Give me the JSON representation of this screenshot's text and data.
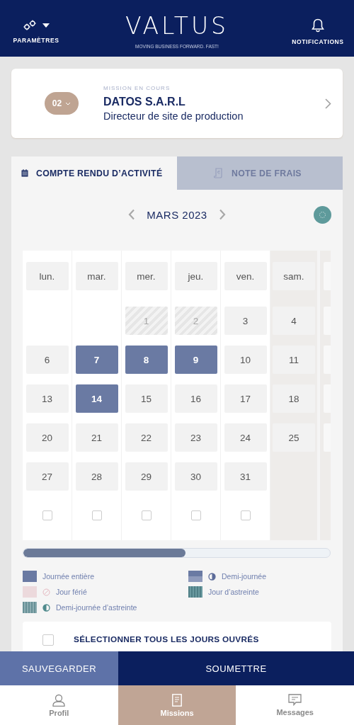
{
  "header": {
    "settings_label": "PARAMÈTRES",
    "logo": "VALTUS",
    "tagline": "MOVING BUSINESS FORWARD. FAST!",
    "notifications_label": "NOTIFICATIONS"
  },
  "mission": {
    "badge": "02",
    "caption": "MISSION EN COURS",
    "company": "DATOS S.A.R.L",
    "role": "Directeur de site de production"
  },
  "tabs": [
    {
      "label": "COMPTE RENDU D’ACTIVITÉ",
      "selected": true,
      "kind": "calendar"
    },
    {
      "label": "NOTE DE FRAIS",
      "selected": false,
      "kind": "receipt"
    }
  ],
  "month": "MARS 2023",
  "columns": [
    {
      "header": "lun.",
      "weekend": false,
      "checked": false,
      "days": [
        {
          "kind": "empty"
        },
        {
          "label": "6",
          "selected": false,
          "disabled": false
        },
        {
          "label": "13",
          "selected": false,
          "disabled": false
        },
        {
          "label": "20",
          "selected": false,
          "disabled": false
        },
        {
          "label": "27",
          "selected": false,
          "disabled": false
        }
      ]
    },
    {
      "header": "mar.",
      "weekend": false,
      "checked": false,
      "days": [
        {
          "kind": "empty"
        },
        {
          "label": "7",
          "selected": true,
          "disabled": false
        },
        {
          "label": "14",
          "selected": true,
          "disabled": false
        },
        {
          "label": "21",
          "selected": false,
          "disabled": false
        },
        {
          "label": "28",
          "selected": false,
          "disabled": false
        }
      ]
    },
    {
      "header": "mer.",
      "weekend": false,
      "checked": false,
      "days": [
        {
          "label": "1",
          "selected": false,
          "disabled": true
        },
        {
          "label": "8",
          "selected": true,
          "disabled": false
        },
        {
          "label": "15",
          "selected": false,
          "disabled": false
        },
        {
          "label": "22",
          "selected": false,
          "disabled": false
        },
        {
          "label": "29",
          "selected": false,
          "disabled": false
        }
      ]
    },
    {
      "header": "jeu.",
      "weekend": false,
      "checked": false,
      "days": [
        {
          "label": "2",
          "selected": false,
          "disabled": true
        },
        {
          "label": "9",
          "selected": true,
          "disabled": false
        },
        {
          "label": "16",
          "selected": false,
          "disabled": false
        },
        {
          "label": "23",
          "selected": false,
          "disabled": false
        },
        {
          "label": "30",
          "selected": false,
          "disabled": false
        }
      ]
    },
    {
      "header": "ven.",
      "weekend": false,
      "checked": false,
      "days": [
        {
          "label": "3",
          "selected": false,
          "disabled": false
        },
        {
          "label": "10",
          "selected": false,
          "disabled": false
        },
        {
          "label": "17",
          "selected": false,
          "disabled": false
        },
        {
          "label": "24",
          "selected": false,
          "disabled": false
        },
        {
          "label": "31",
          "selected": false,
          "disabled": false
        }
      ]
    },
    {
      "header": "sam.",
      "weekend": true,
      "days": [
        {
          "label": "4",
          "selected": false,
          "disabled": false
        },
        {
          "label": "11",
          "selected": false,
          "disabled": false
        },
        {
          "label": "18",
          "selected": false,
          "disabled": false
        },
        {
          "label": "25",
          "selected": false,
          "disabled": false
        },
        {
          "kind": "empty"
        }
      ]
    }
  ],
  "legend": [
    {
      "label": "Journée entière",
      "kind": "full"
    },
    {
      "label": "Demi-journée",
      "kind": "half"
    },
    {
      "label": "Jour férié",
      "kind": "holiday"
    },
    {
      "label": "Jour d’astreinte",
      "kind": "oncall"
    },
    {
      "label": "Demi-journée d’astreinte",
      "kind": "half_oncall"
    }
  ],
  "select_all": {
    "label": "SÉLECTIONNER TOUS LES JOURS OUVRÉS",
    "checked": false
  },
  "actions": [
    {
      "label": "SAUVEGARDER",
      "kind": "secondary"
    },
    {
      "label": "SOUMETTRE",
      "kind": "primary"
    }
  ],
  "bottom_nav": [
    {
      "label": "Profil",
      "selected": false,
      "kind": "person"
    },
    {
      "label": "Missions",
      "selected": true,
      "kind": "document"
    },
    {
      "label": "Messages",
      "selected": false,
      "kind": "chat"
    }
  ]
}
